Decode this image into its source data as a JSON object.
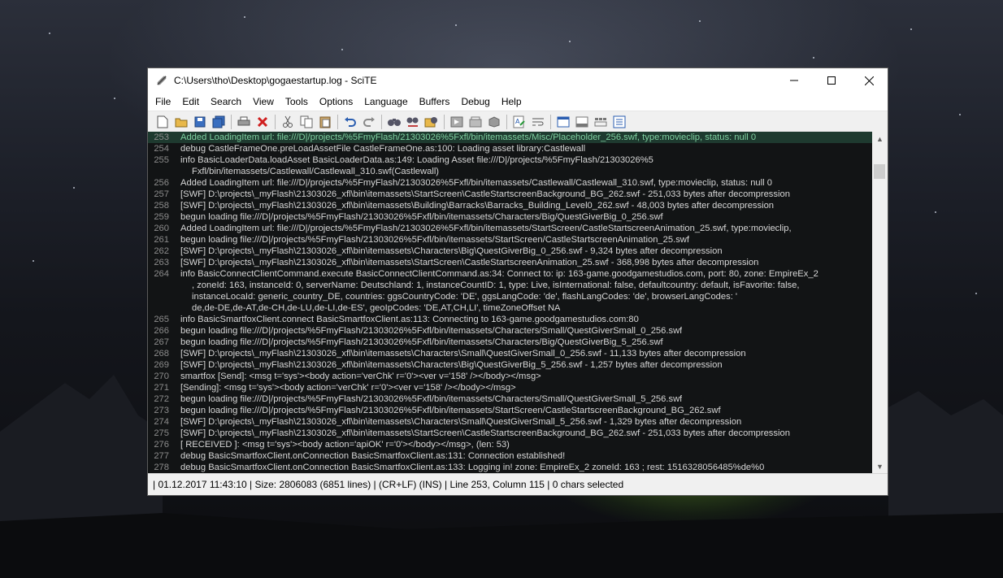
{
  "window": {
    "title": "C:\\Users\\tho\\Desktop\\gogaestartup.log - SciTE",
    "minimize_symbol": "—",
    "maximize_symbol": "☐",
    "close_symbol": "✕"
  },
  "menu": [
    "File",
    "Edit",
    "Search",
    "View",
    "Tools",
    "Options",
    "Language",
    "Buffers",
    "Debug",
    "Help"
  ],
  "toolbar": [
    "new-file-icon",
    "open-file-icon",
    "save-icon",
    "save-all-icon",
    "print-icon",
    "close-file-icon",
    "cut-icon",
    "copy-icon",
    "paste-icon",
    "undo-icon",
    "redo-icon",
    "find-icon",
    "replace-icon",
    "find-in-files-icon",
    "go-icon",
    "build-icon",
    "compile-icon",
    "abbrev-icon",
    "wrap-icon",
    "split-view-icon",
    "toggle-output-icon",
    "tab-bar-icon",
    "properties-icon"
  ],
  "editor": {
    "current_line": "253",
    "lines": [
      {
        "n": "253",
        "text": "Added LoadingItem url: file:///D|/projects/%5FmyFlash/21303026%5Fxfl/bin/itemassets/Misc/Placeholder_256.swf, type:movieclip, status: null 0",
        "color": "#7fd0a0"
      },
      {
        "n": "254",
        "text": "debug CastleFrameOne.preLoadAssetFile CastleFrameOne.as:100: Loading asset library:Castlewall",
        "color": "#d6d6d6"
      },
      {
        "n": "255",
        "text": "info BasicLoaderData.loadAsset BasicLoaderData.as:149: Loading Asset file:///D|/projects/%5FmyFlash/21303026%5",
        "color": "#d6d6d6"
      },
      {
        "n": "",
        "text": "Fxfl/bin/itemassets/Castlewall/Castlewall_310.swf(Castlewall)",
        "color": "#d6d6d6"
      },
      {
        "n": "256",
        "text": "Added LoadingItem url: file:///D|/projects/%5FmyFlash/21303026%5Fxfl/bin/itemassets/Castlewall/Castlewall_310.swf, type:movieclip, status: null 0",
        "color": "#d6d6d6"
      },
      {
        "n": "257",
        "text": "[SWF] D:\\projects\\_myFlash\\21303026_xfl\\bin\\itemassets\\StartScreen\\CastleStartscreenBackground_BG_262.swf - 251,033 bytes after decompression",
        "color": "#d6d6d6"
      },
      {
        "n": "258",
        "text": "[SWF] D:\\projects\\_myFlash\\21303026_xfl\\bin\\itemassets\\Building\\Barracks\\Barracks_Building_Level0_262.swf - 48,003 bytes after decompression",
        "color": "#d6d6d6"
      },
      {
        "n": "259",
        "text": "begun loading file:///D|/projects/%5FmyFlash/21303026%5Fxfl/bin/itemassets/Characters/Big/QuestGiverBig_0_256.swf",
        "color": "#d6d6d6"
      },
      {
        "n": "260",
        "text": "Added LoadingItem url: file:///D|/projects/%5FmyFlash/21303026%5Fxfl/bin/itemassets/StartScreen/CastleStartscreenAnimation_25.swf, type:movieclip,",
        "color": "#d6d6d6"
      },
      {
        "n": "261",
        "text": "begun loading file:///D|/projects/%5FmyFlash/21303026%5Fxfl/bin/itemassets/StartScreen/CastleStartscreenAnimation_25.swf",
        "color": "#d6d6d6"
      },
      {
        "n": "262",
        "text": "[SWF] D:\\projects\\_myFlash\\21303026_xfl\\bin\\itemassets\\Characters\\Big\\QuestGiverBig_0_256.swf - 9,324 bytes after decompression",
        "color": "#d6d6d6"
      },
      {
        "n": "263",
        "text": "[SWF] D:\\projects\\_myFlash\\21303026_xfl\\bin\\itemassets\\StartScreen\\CastleStartscreenAnimation_25.swf - 368,998 bytes after decompression",
        "color": "#d6d6d6"
      },
      {
        "n": "264",
        "text": "info BasicConnectClientCommand.execute BasicConnectClientCommand.as:34: Connect to: ip: 163-game.goodgamestudios.com, port: 80, zone: EmpireEx_2",
        "color": "#d6d6d6"
      },
      {
        "n": "",
        "text": ", zoneId: 163, instanceId: 0, serverName: Deutschland: 1, instanceCountID: 1, type: Live, isInternational: false, defaultcountry: default, isFavorite: false,",
        "color": "#d6d6d6"
      },
      {
        "n": "",
        "text": "instanceLocaId: generic_country_DE, countries: ggsCountryCode: 'DE', ggsLangCode: 'de', flashLangCodes: 'de', browserLangCodes: '",
        "color": "#d6d6d6"
      },
      {
        "n": "",
        "text": "de,de-DE,de-AT,de-CH,de-LU,de-LI,de-ES', geoIpCodes: 'DE,AT,CH,LI', timeZoneOffset NA",
        "color": "#d6d6d6"
      },
      {
        "n": "265",
        "text": "info BasicSmartfoxClient.connect BasicSmartfoxClient.as:113: Connecting to 163-game.goodgamestudios.com:80",
        "color": "#d6d6d6"
      },
      {
        "n": "266",
        "text": "begun loading file:///D|/projects/%5FmyFlash/21303026%5Fxfl/bin/itemassets/Characters/Small/QuestGiverSmall_0_256.swf",
        "color": "#d6d6d6"
      },
      {
        "n": "267",
        "text": "begun loading file:///D|/projects/%5FmyFlash/21303026%5Fxfl/bin/itemassets/Characters/Big/QuestGiverBig_5_256.swf",
        "color": "#d6d6d6"
      },
      {
        "n": "268",
        "text": "[SWF] D:\\projects\\_myFlash\\21303026_xfl\\bin\\itemassets\\Characters\\Small\\QuestGiverSmall_0_256.swf - 11,133 bytes after decompression",
        "color": "#d6d6d6"
      },
      {
        "n": "269",
        "text": "[SWF] D:\\projects\\_myFlash\\21303026_xfl\\bin\\itemassets\\Characters\\Big\\QuestGiverBig_5_256.swf - 1,257 bytes after decompression",
        "color": "#d6d6d6"
      },
      {
        "n": "270",
        "text": "smartfox [Send]: <msg t='sys'><body action='verChk' r='0'><ver v='158' /></body></msg>",
        "color": "#d6d6d6"
      },
      {
        "n": "271",
        "text": "[Sending]: <msg t='sys'><body action='verChk' r='0'><ver v='158' /></body></msg>",
        "color": "#d6d6d6"
      },
      {
        "n": "272",
        "text": "begun loading file:///D|/projects/%5FmyFlash/21303026%5Fxfl/bin/itemassets/Characters/Small/QuestGiverSmall_5_256.swf",
        "color": "#d6d6d6"
      },
      {
        "n": "273",
        "text": "begun loading file:///D|/projects/%5FmyFlash/21303026%5Fxfl/bin/itemassets/StartScreen/CastleStartscreenBackground_BG_262.swf",
        "color": "#d6d6d6"
      },
      {
        "n": "274",
        "text": "[SWF] D:\\projects\\_myFlash\\21303026_xfl\\bin\\itemassets\\Characters\\Small\\QuestGiverSmall_5_256.swf - 1,329 bytes after decompression",
        "color": "#d6d6d6"
      },
      {
        "n": "275",
        "text": "[SWF] D:\\projects\\_myFlash\\21303026_xfl\\bin\\itemassets\\StartScreen\\CastleStartscreenBackground_BG_262.swf - 251,033 bytes after decompression",
        "color": "#d6d6d6"
      },
      {
        "n": "276",
        "text": "[ RECEIVED ]: <msg t='sys'><body action='apiOK' r='0'></body></msg>, (len: 53)",
        "color": "#d6d6d6"
      },
      {
        "n": "277",
        "text": "debug BasicSmartfoxClient.onConnection BasicSmartfoxClient.as:131: Connection established!",
        "color": "#d6d6d6"
      },
      {
        "n": "278",
        "text": "debug BasicSmartfoxClient.onConnection BasicSmartfoxClient.as:133: Logging in! zone: EmpireEx_2 zoneId: 163 ; rest: 1516328056485%de%0",
        "color": "#d6d6d6"
      }
    ]
  },
  "statusbar": {
    "text": "| 01.12.2017 11:43:10 | Size: 2806083 (6851 lines) | (CR+LF) (INS) | Line 253, Column 115 | 0 chars selected"
  },
  "colors": {
    "editor_bg": "#121415",
    "current_line_bg": "#1e3a2f",
    "keyword_info": "#d27b7b",
    "number": "#7fb5e0"
  }
}
